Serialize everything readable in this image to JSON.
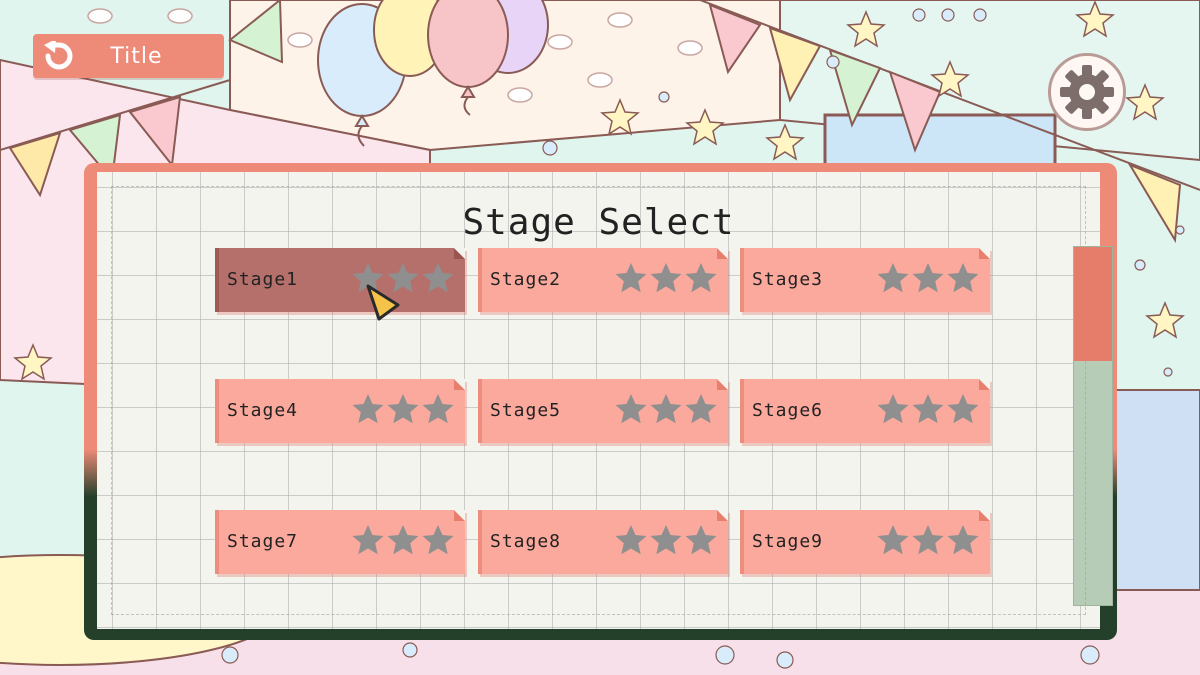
{
  "header": {
    "title_button_label": "Title"
  },
  "panel": {
    "title": "Stage Select"
  },
  "stages": [
    {
      "label": "Stage1",
      "stars_earned": 0,
      "stars_total": 3,
      "selected": true
    },
    {
      "label": "Stage2",
      "stars_earned": 0,
      "stars_total": 3,
      "selected": false
    },
    {
      "label": "Stage3",
      "stars_earned": 0,
      "stars_total": 3,
      "selected": false
    },
    {
      "label": "Stage4",
      "stars_earned": 0,
      "stars_total": 3,
      "selected": false
    },
    {
      "label": "Stage5",
      "stars_earned": 0,
      "stars_total": 3,
      "selected": false
    },
    {
      "label": "Stage6",
      "stars_earned": 0,
      "stars_total": 3,
      "selected": false
    },
    {
      "label": "Stage7",
      "stars_earned": 0,
      "stars_total": 3,
      "selected": false
    },
    {
      "label": "Stage8",
      "stars_earned": 0,
      "stars_total": 3,
      "selected": false
    },
    {
      "label": "Stage9",
      "stars_earned": 0,
      "stars_total": 3,
      "selected": false
    }
  ],
  "scrollbar": {
    "scroll_position": 0
  },
  "icons": {
    "back": "back-arrow-icon",
    "settings": "gear-icon",
    "star": "star-icon",
    "cursor": "pointer-cursor-icon"
  },
  "colors": {
    "accent": "#ee8b78",
    "card": "#fca99d",
    "card_selected": "#b6706c",
    "star_empty": "#8f8f8f",
    "panel_dark": "#24402a",
    "scroll_track": "#b6ccb6",
    "scroll_thumb": "#e67d6a",
    "cursor": "#f5c24a"
  }
}
